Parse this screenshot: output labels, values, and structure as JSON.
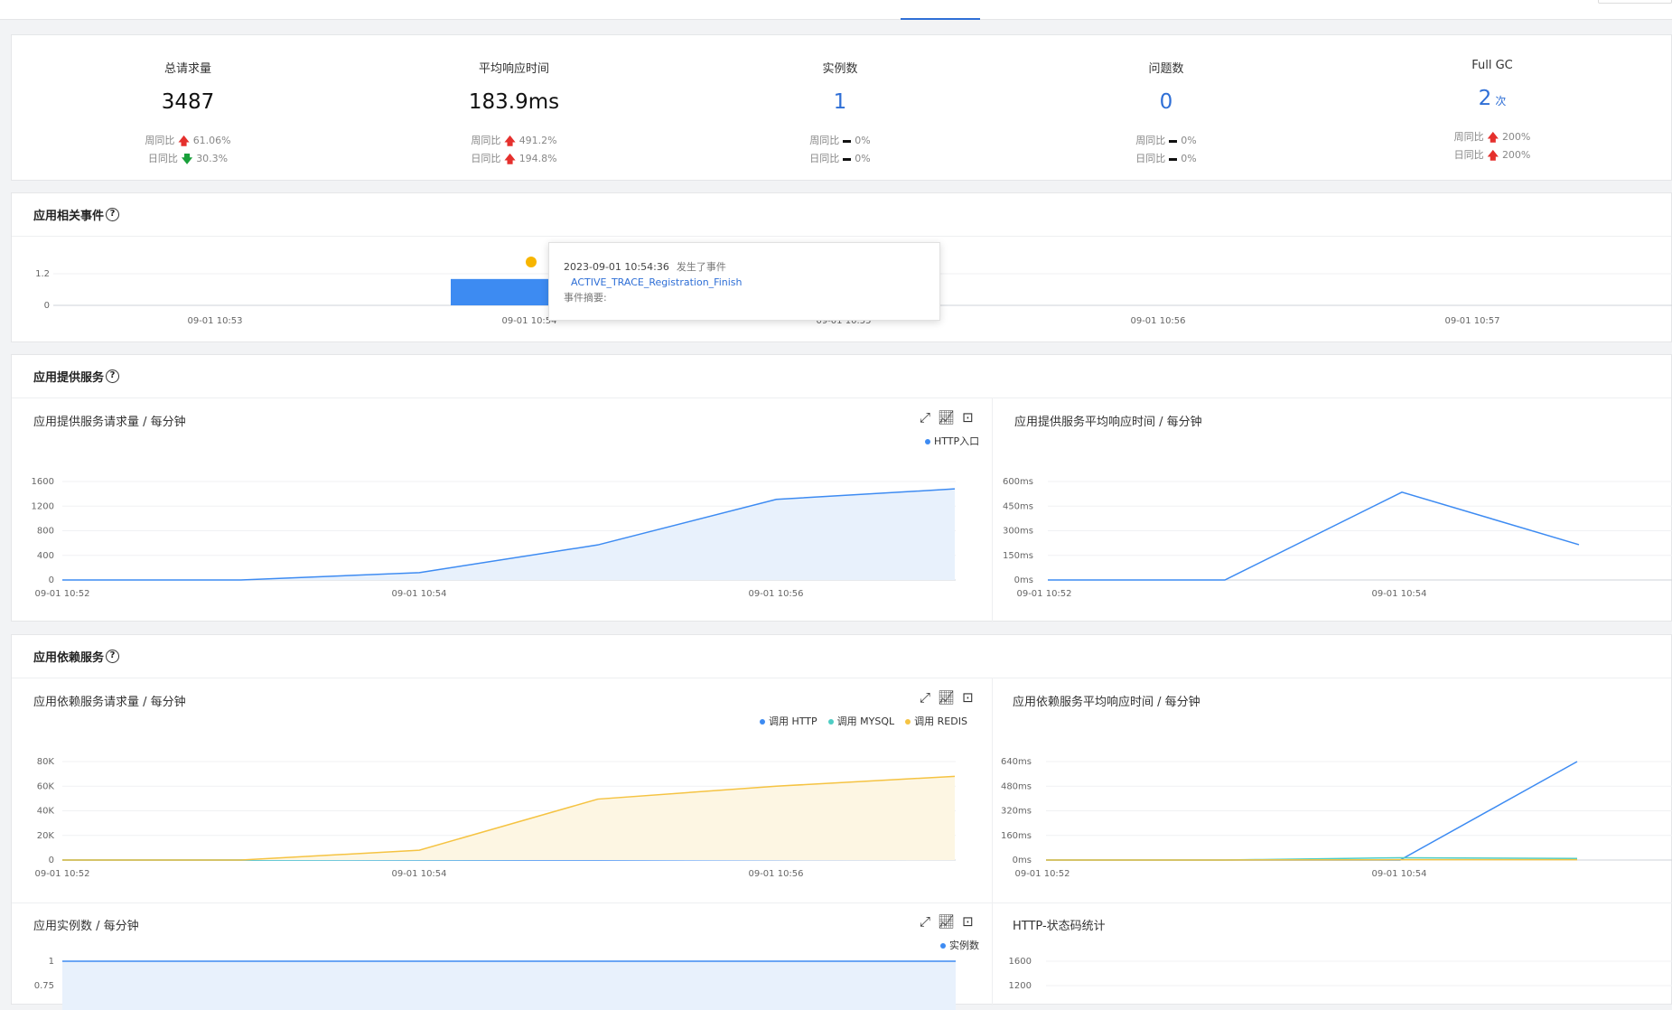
{
  "stats": [
    {
      "label": "总请求量",
      "value": "3487",
      "unit": "",
      "blue": false,
      "week_label": "周同比",
      "week_dir": "up",
      "week_val": "61.06%",
      "day_label": "日同比",
      "day_dir": "down",
      "day_val": "30.3%"
    },
    {
      "label": "平均响应时间",
      "value": "183.9ms",
      "unit": "",
      "blue": false,
      "week_label": "周同比",
      "week_dir": "up",
      "week_val": "491.2%",
      "day_label": "日同比",
      "day_dir": "up",
      "day_val": "194.8%"
    },
    {
      "label": "实例数",
      "value": "1",
      "unit": "",
      "blue": true,
      "week_label": "周同比",
      "week_dir": "flat",
      "week_val": "0%",
      "day_label": "日同比",
      "day_dir": "flat",
      "day_val": "0%"
    },
    {
      "label": "问题数",
      "value": "0",
      "unit": "",
      "blue": true,
      "week_label": "周同比",
      "week_dir": "flat",
      "week_val": "0%",
      "day_label": "日同比",
      "day_dir": "flat",
      "day_val": "0%"
    },
    {
      "label": "Full GC",
      "value": "2",
      "unit": "次",
      "blue": true,
      "week_label": "周同比",
      "week_dir": "up",
      "week_val": "200%",
      "day_label": "日同比",
      "day_dir": "up",
      "day_val": "200%"
    }
  ],
  "sections": {
    "events": "应用相关事件",
    "provided": "应用提供服务",
    "dependent": "应用依赖服务"
  },
  "help_glyph": "?",
  "tooltip": {
    "time": "2023-09-01 10:54:36",
    "action": "发生了事件",
    "event_name": "ACTIVE_TRACE_Registration_Finish",
    "summary": "事件摘要:"
  },
  "icons": [
    "expand-icon",
    "line-chart-icon",
    "terminal-icon"
  ],
  "colors": {
    "blue": "#3d8bf2",
    "teal": "#4ecdc4",
    "yellow": "#f5c342",
    "blue_fill": "#e8f1fc",
    "yellow_fill": "#fdf6e3",
    "event_dot": "#f7b500"
  },
  "chart_data": [
    {
      "id": "events",
      "type": "bar",
      "title": "应用相关事件",
      "y_ticks": [
        "0",
        "1.2"
      ],
      "x_ticks": [
        "09-01 10:53",
        "09-01 10:54",
        "09-01 10:55",
        "09-01 10:56",
        "09-01 10:57"
      ],
      "ylim": [
        0,
        1.2
      ],
      "events": [
        {
          "time": "09-01 10:54",
          "value": 1
        }
      ]
    },
    {
      "id": "provided_requests",
      "type": "area",
      "title": "应用提供服务请求量 / 每分钟",
      "legend": [
        "HTTP入口"
      ],
      "y_ticks": [
        "0",
        "400",
        "800",
        "1200",
        "1600"
      ],
      "ylim": [
        0,
        1600
      ],
      "x": [
        "10:52",
        "10:53",
        "10:54",
        "10:55",
        "10:56",
        "10:57"
      ],
      "x_ticks": [
        "09-01 10:52",
        "09-01 10:54",
        "09-01 10:56"
      ],
      "series": [
        {
          "name": "HTTP入口",
          "values": [
            0,
            0,
            120,
            570,
            1310,
            1480
          ]
        }
      ]
    },
    {
      "id": "provided_latency",
      "type": "line",
      "title": "应用提供服务平均响应时间 / 每分钟",
      "y_ticks": [
        "0ms",
        "150ms",
        "300ms",
        "450ms",
        "600ms"
      ],
      "ylim": [
        0,
        600
      ],
      "x": [
        "10:52",
        "10:53",
        "10:54",
        "10:55"
      ],
      "x_ticks": [
        "09-01 10:52",
        "09-01 10:54"
      ],
      "series": [
        {
          "values": [
            0,
            0,
            535,
            215
          ]
        }
      ]
    },
    {
      "id": "dep_requests",
      "type": "area",
      "title": "应用依赖服务请求量 / 每分钟",
      "legend": [
        "调用 HTTP",
        "调用 MYSQL",
        "调用 REDIS"
      ],
      "y_ticks": [
        "0",
        "20K",
        "40K",
        "60K",
        "80K"
      ],
      "ylim": [
        0,
        80000
      ],
      "x": [
        "10:52",
        "10:53",
        "10:54",
        "10:55",
        "10:56",
        "10:57"
      ],
      "x_ticks": [
        "09-01 10:52",
        "09-01 10:54",
        "09-01 10:56"
      ],
      "series": [
        {
          "name": "调用 HTTP",
          "values": [
            0,
            0,
            0,
            0,
            400,
            600
          ]
        },
        {
          "name": "调用 MYSQL",
          "values": [
            0,
            0,
            300,
            700,
            1500,
            1800
          ]
        },
        {
          "name": "调用 REDIS",
          "values": [
            0,
            0,
            8000,
            49500,
            60000,
            68000
          ]
        }
      ]
    },
    {
      "id": "dep_latency",
      "type": "line",
      "title": "应用依赖服务平均响应时间 / 每分钟",
      "y_ticks": [
        "0ms",
        "160ms",
        "320ms",
        "480ms",
        "640ms"
      ],
      "ylim": [
        0,
        640
      ],
      "x": [
        "10:52",
        "10:53",
        "10:54",
        "10:55"
      ],
      "x_ticks": [
        "09-01 10:52",
        "09-01 10:54"
      ],
      "series": [
        {
          "values": [
            0,
            0,
            0,
            640
          ]
        },
        {
          "values": [
            0,
            0,
            15,
            10
          ]
        },
        {
          "values": [
            0,
            0,
            2,
            2
          ]
        }
      ]
    },
    {
      "id": "instances",
      "type": "area",
      "title": "应用实例数 / 每分钟",
      "legend": [
        "实例数"
      ],
      "y_ticks": [
        "1",
        "0.75"
      ],
      "series": [
        {
          "name": "实例数",
          "values": [
            1,
            1,
            1,
            1,
            1,
            1
          ]
        }
      ]
    },
    {
      "id": "http_status",
      "type": "line",
      "title": "HTTP-状态码统计",
      "y_ticks": [
        "1600",
        "1200"
      ]
    }
  ]
}
